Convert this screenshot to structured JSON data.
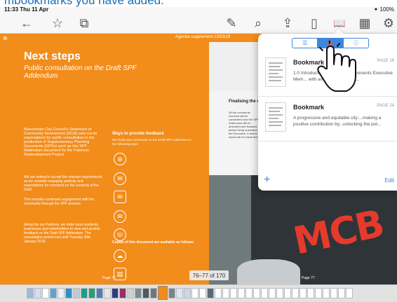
{
  "caption": {
    "text": "mbookmarks you have added."
  },
  "status": {
    "time": "11:33  Thu 11 Apr",
    "right": "✦ 100%"
  },
  "toolbar": {
    "back": "←",
    "star": "☆",
    "sidebar": "⧉",
    "pen": "✎",
    "search": "⌕",
    "share": "⇪",
    "bookmark": "▯",
    "book": "📖",
    "grid": "▦",
    "gear": "⚙"
  },
  "doc": {
    "header_x": "⊗",
    "agenda": "Agenda supplement 13/03/19",
    "next_steps": "Next steps",
    "subtitle": "Public consultation on the Draft SPF Addendum",
    "para1": "Manchester City Council's Statement of Community Involvement (2018) sets out its expectations for public consultation in the production of Supplementary Planning Documents (SPDs) such as this SPF Addendum document for the Paterson Redevelopment Project.",
    "para2": "We are asking to accept the relevant requirements as we consider engaging publicity and expectations for comment on the contents of the Draft.",
    "para3": "This includes continued engagement with the community through the SPF process.",
    "para4": "Along the our Partners, we invite local residents, businesses and stakeholders to view and provide feedback on the Draft SPF Addendum. The consultation period runs until Tuesday 30th January 2019.",
    "ways_title": "Ways to provide feedback",
    "ways_intro": "We invite your comments on the Draft SPF Addendum in the following ways:",
    "copies_title": "Copies of this document are available as follows:",
    "fin_title": "Finalising the d... endorsement b...",
    "fin_txt": "All the comments received will be considered and the SPF Addendum will be amended and finalised before being submitted to the Executive. A further report will be made then.",
    "counter": "76–77 of 170",
    "page_left": "Page 76",
    "page_right": "Page 77"
  },
  "popover": {
    "seg_list": "☰",
    "seg_bm": "🔖",
    "seg_info": "ⓘ",
    "items": [
      {
        "title": "Bookmark",
        "page": "PAGE 18",
        "desc": "1.0 Introduct... 1.1 This report presents Executive Mem... with an ...ail regarding t..."
      },
      {
        "title": "Bookmark",
        "page": "PAGE 24",
        "desc": "A progressive and equitable city:...making a positive contribution by...unlocking the pot..."
      }
    ],
    "plus": "+",
    "edit": "Edit"
  }
}
